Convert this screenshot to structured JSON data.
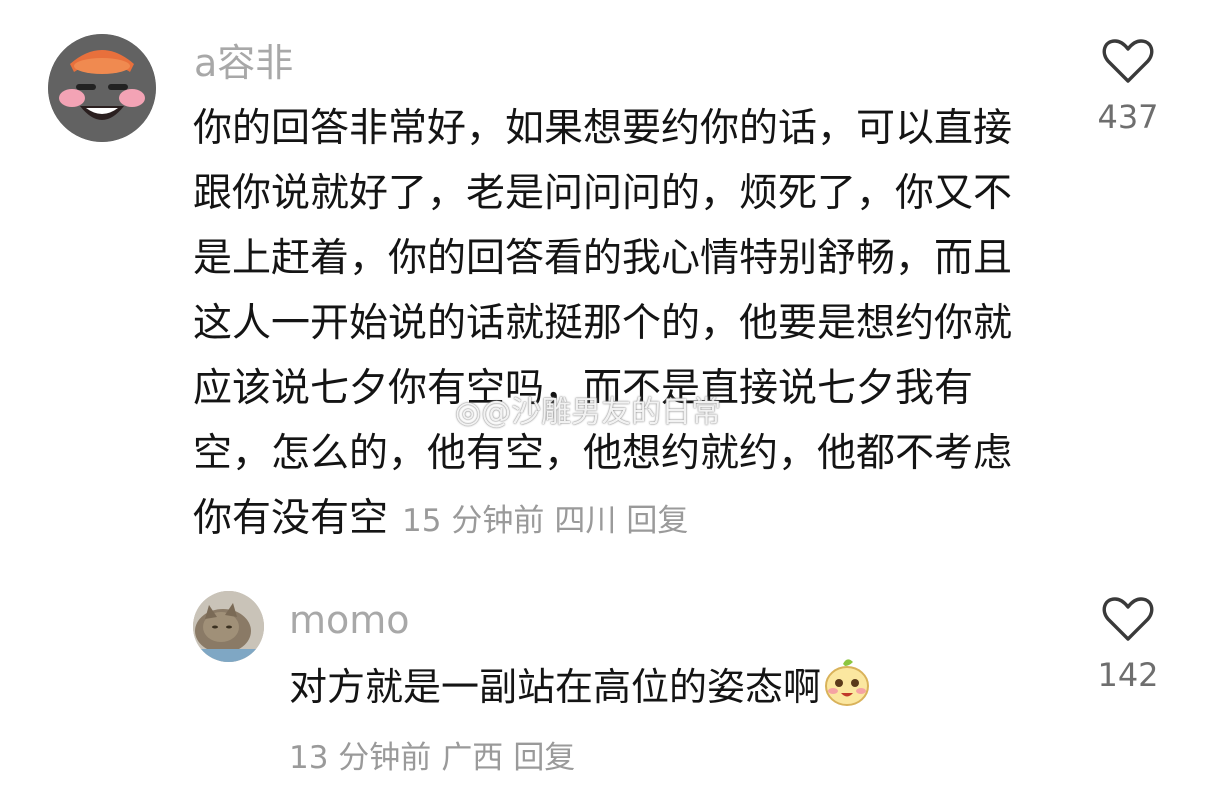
{
  "comment": {
    "username": "a容非",
    "text": "你的回答非常好，如果想要约你的话，可以直接跟你说就好了，老是问问问的，烦死了，你又不是上赶着，你的回答看的我心情特别舒畅，而且这人一开始说的话就挺那个的，他要是想约你就应该说七夕你有空吗，而不是直接说七夕我有空，怎么的，他有空，他想约就约，他都不考虑你有没有空",
    "time": "15 分钟前",
    "location": "四川",
    "reply_label": "回复",
    "like_count": "437",
    "like_icon": "heart-outline-icon"
  },
  "reply": {
    "username": "momo",
    "text": "对方就是一副站在高位的姿态啊",
    "emoji": "smiling-face-emoji",
    "time": "13 分钟前",
    "location": "广西",
    "reply_label": "回复",
    "like_count": "142",
    "like_icon": "heart-outline-icon"
  },
  "watermark": {
    "text": "@沙雕男友的日常"
  },
  "colors": {
    "text": "#141414",
    "meta": "#9a9a9a",
    "username": "#a8a8a8"
  }
}
